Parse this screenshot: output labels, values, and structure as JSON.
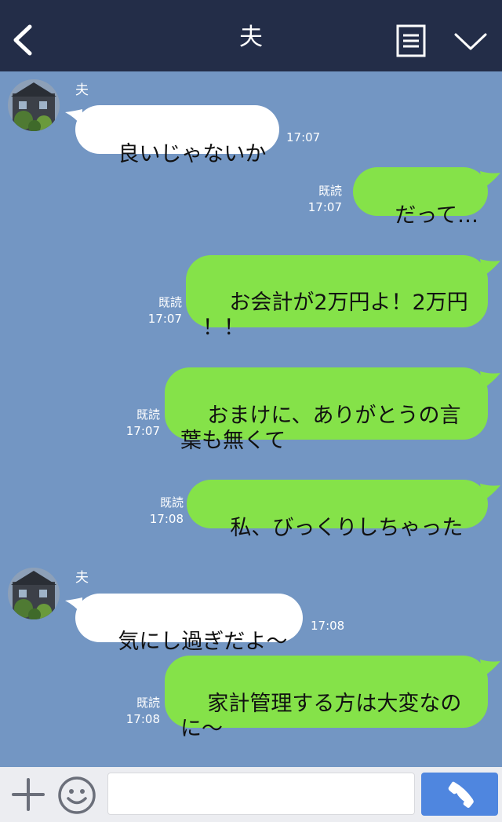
{
  "header": {
    "title": "夫",
    "back_icon": "chevron-left-icon",
    "menu_icon": "document-menu-icon",
    "expand_icon": "chevron-down-icon"
  },
  "messages": [
    {
      "side": "in",
      "sender": "夫",
      "text": "良いじゃないか",
      "time": "17:07"
    },
    {
      "side": "out",
      "read": "既読",
      "text": "だって…",
      "time": "17:07"
    },
    {
      "side": "out",
      "read": "既読",
      "text": "お会計が2万円よ！2万円\n！！",
      "time": "17:07"
    },
    {
      "side": "out",
      "read": "既読",
      "text": "おまけに、ありがとうの言\n葉も無くて",
      "time": "17:07"
    },
    {
      "side": "out",
      "read": "既読",
      "text": "私、びっくりしちゃった",
      "time": "17:08"
    },
    {
      "side": "in",
      "sender": "夫",
      "text": "気にし過ぎだよ～",
      "time": "17:08"
    },
    {
      "side": "out",
      "read": "既読",
      "text": "家計管理する方は大変なの\nに～",
      "time": "17:08"
    }
  ],
  "footer": {
    "plus_icon": "plus-icon",
    "emoji_icon": "smiley-icon",
    "input_value": "",
    "call_icon": "phone-icon"
  },
  "colors": {
    "header_bg": "#232d48",
    "chat_bg": "#7396c3",
    "outgoing_bubble": "#85e249",
    "incoming_bubble": "#ffffff",
    "call_button": "#4f86df"
  }
}
